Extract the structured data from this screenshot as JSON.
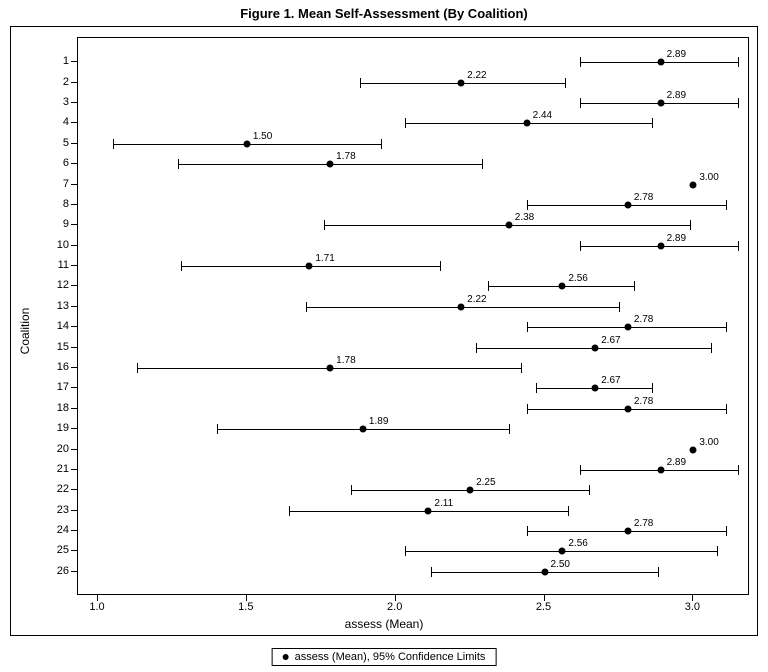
{
  "chart_data": {
    "type": "dot-ci",
    "title": "Figure 1. Mean Self-Assessment (By Coalition)",
    "xlabel": "assess (Mean)",
    "ylabel": "Coalition",
    "xlim": [
      1.0,
      3.15
    ],
    "x_ticks": [
      1.0,
      1.5,
      2.0,
      2.5,
      3.0
    ],
    "x_tick_labels": [
      "1.0",
      "1.5",
      "2.0",
      "2.5",
      "3.0"
    ],
    "y_categories": [
      "1",
      "2",
      "3",
      "4",
      "5",
      "6",
      "7",
      "8",
      "9",
      "10",
      "11",
      "12",
      "13",
      "14",
      "15",
      "16",
      "17",
      "18",
      "19",
      "20",
      "21",
      "22",
      "23",
      "24",
      "25",
      "26"
    ],
    "legend": "assess (Mean), 95% Confidence Limits",
    "series": [
      {
        "coalition": "1",
        "mean": 2.89,
        "label": "2.89",
        "lo": 2.62,
        "hi": 3.15
      },
      {
        "coalition": "2",
        "mean": 2.22,
        "label": "2.22",
        "lo": 1.88,
        "hi": 2.57
      },
      {
        "coalition": "3",
        "mean": 2.89,
        "label": "2.89",
        "lo": 2.62,
        "hi": 3.15
      },
      {
        "coalition": "4",
        "mean": 2.44,
        "label": "2.44",
        "lo": 2.03,
        "hi": 2.86
      },
      {
        "coalition": "5",
        "mean": 1.5,
        "label": "1.50",
        "lo": 1.05,
        "hi": 1.95
      },
      {
        "coalition": "6",
        "mean": 1.78,
        "label": "1.78",
        "lo": 1.27,
        "hi": 2.29
      },
      {
        "coalition": "7",
        "mean": 3.0,
        "label": "3.00",
        "lo": 3.0,
        "hi": 3.0
      },
      {
        "coalition": "8",
        "mean": 2.78,
        "label": "2.78",
        "lo": 2.44,
        "hi": 3.11
      },
      {
        "coalition": "9",
        "mean": 2.38,
        "label": "2.38",
        "lo": 1.76,
        "hi": 2.99
      },
      {
        "coalition": "10",
        "mean": 2.89,
        "label": "2.89",
        "lo": 2.62,
        "hi": 3.15
      },
      {
        "coalition": "11",
        "mean": 1.71,
        "label": "1.71",
        "lo": 1.28,
        "hi": 2.15
      },
      {
        "coalition": "12",
        "mean": 2.56,
        "label": "2.56",
        "lo": 2.31,
        "hi": 2.8
      },
      {
        "coalition": "13",
        "mean": 2.22,
        "label": "2.22",
        "lo": 1.7,
        "hi": 2.75
      },
      {
        "coalition": "14",
        "mean": 2.78,
        "label": "2.78",
        "lo": 2.44,
        "hi": 3.11
      },
      {
        "coalition": "15",
        "mean": 2.67,
        "label": "2.67",
        "lo": 2.27,
        "hi": 3.06
      },
      {
        "coalition": "16",
        "mean": 1.78,
        "label": "1.78",
        "lo": 1.13,
        "hi": 2.42
      },
      {
        "coalition": "17",
        "mean": 2.67,
        "label": "2.67",
        "lo": 2.47,
        "hi": 2.86
      },
      {
        "coalition": "18",
        "mean": 2.78,
        "label": "2.78",
        "lo": 2.44,
        "hi": 3.11
      },
      {
        "coalition": "19",
        "mean": 1.89,
        "label": "1.89",
        "lo": 1.4,
        "hi": 2.38
      },
      {
        "coalition": "20",
        "mean": 3.0,
        "label": "3.00",
        "lo": 3.0,
        "hi": 3.0
      },
      {
        "coalition": "21",
        "mean": 2.89,
        "label": "2.89",
        "lo": 2.62,
        "hi": 3.15
      },
      {
        "coalition": "22",
        "mean": 2.25,
        "label": "2.25",
        "lo": 1.85,
        "hi": 2.65
      },
      {
        "coalition": "23",
        "mean": 2.11,
        "label": "2.11",
        "lo": 1.64,
        "hi": 2.58
      },
      {
        "coalition": "24",
        "mean": 2.78,
        "label": "2.78",
        "lo": 2.44,
        "hi": 3.11
      },
      {
        "coalition": "25",
        "mean": 2.56,
        "label": "2.56",
        "lo": 2.03,
        "hi": 3.08
      },
      {
        "coalition": "26",
        "mean": 2.5,
        "label": "2.50",
        "lo": 2.12,
        "hi": 2.88
      }
    ]
  }
}
